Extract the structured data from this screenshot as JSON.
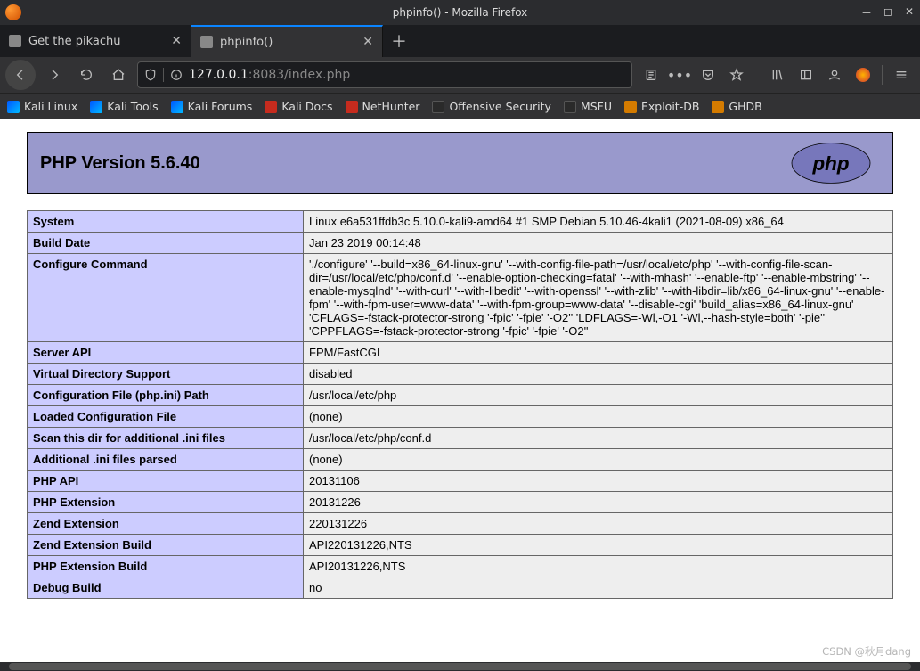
{
  "window": {
    "title": "phpinfo() - Mozilla Firefox"
  },
  "tabs": [
    {
      "label": "Get the pikachu",
      "active": false
    },
    {
      "label": "phpinfo()",
      "active": true
    }
  ],
  "url": {
    "host": "127.0.0.1",
    "port": ":8083",
    "path": "/index.php"
  },
  "bookmarks": [
    {
      "label": "Kali Linux",
      "icon": "kali"
    },
    {
      "label": "Kali Tools",
      "icon": "kali"
    },
    {
      "label": "Kali Forums",
      "icon": "kali"
    },
    {
      "label": "Kali Docs",
      "icon": "red"
    },
    {
      "label": "NetHunter",
      "icon": "red"
    },
    {
      "label": "Offensive Security",
      "icon": "dark"
    },
    {
      "label": "MSFU",
      "icon": "dark"
    },
    {
      "label": "Exploit-DB",
      "icon": "orange"
    },
    {
      "label": "GHDB",
      "icon": "orange"
    }
  ],
  "phpinfo": {
    "heading": "PHP Version 5.6.40",
    "rows": [
      {
        "key": "System",
        "value": "Linux e6a531ffdb3c 5.10.0-kali9-amd64 #1 SMP Debian 5.10.46-4kali1 (2021-08-09) x86_64"
      },
      {
        "key": "Build Date",
        "value": "Jan 23 2019 00:14:48"
      },
      {
        "key": "Configure Command",
        "value": "'./configure' '--build=x86_64-linux-gnu' '--with-config-file-path=/usr/local/etc/php' '--with-config-file-scan-dir=/usr/local/etc/php/conf.d' '--enable-option-checking=fatal' '--with-mhash' '--enable-ftp' '--enable-mbstring' '--enable-mysqlnd' '--with-curl' '--with-libedit' '--with-openssl' '--with-zlib' '--with-libdir=lib/x86_64-linux-gnu' '--enable-fpm' '--with-fpm-user=www-data' '--with-fpm-group=www-data' '--disable-cgi' 'build_alias=x86_64-linux-gnu' 'CFLAGS=-fstack-protector-strong '-fpic' '-fpie' '-O2'' 'LDFLAGS=-Wl,-O1 '-Wl,--hash-style=both' '-pie'' 'CPPFLAGS=-fstack-protector-strong '-fpic' '-fpie' '-O2''"
      },
      {
        "key": "Server API",
        "value": "FPM/FastCGI"
      },
      {
        "key": "Virtual Directory Support",
        "value": "disabled"
      },
      {
        "key": "Configuration File (php.ini) Path",
        "value": "/usr/local/etc/php"
      },
      {
        "key": "Loaded Configuration File",
        "value": "(none)"
      },
      {
        "key": "Scan this dir for additional .ini files",
        "value": "/usr/local/etc/php/conf.d"
      },
      {
        "key": "Additional .ini files parsed",
        "value": "(none)"
      },
      {
        "key": "PHP API",
        "value": "20131106"
      },
      {
        "key": "PHP Extension",
        "value": "20131226"
      },
      {
        "key": "Zend Extension",
        "value": "220131226"
      },
      {
        "key": "Zend Extension Build",
        "value": "API220131226,NTS"
      },
      {
        "key": "PHP Extension Build",
        "value": "API20131226,NTS"
      },
      {
        "key": "Debug Build",
        "value": "no"
      }
    ]
  },
  "watermark": "CSDN @秋月dang"
}
